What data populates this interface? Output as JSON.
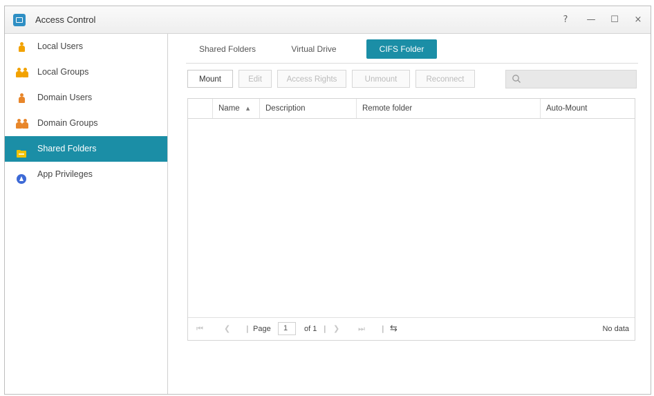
{
  "window": {
    "title": "Access Control",
    "controls": {
      "help": "?",
      "minimize": "—",
      "maximize": "☐",
      "close": "×"
    }
  },
  "sidebar": {
    "items": [
      {
        "label": "Local Users",
        "icon": "user-icon",
        "active": false
      },
      {
        "label": "Local Groups",
        "icon": "group-icon",
        "active": false
      },
      {
        "label": "Domain Users",
        "icon": "user-icon",
        "active": false
      },
      {
        "label": "Domain Groups",
        "icon": "group-icon",
        "active": false
      },
      {
        "label": "Shared Folders",
        "icon": "folder-icon",
        "active": true
      },
      {
        "label": "App Privileges",
        "icon": "app-icon",
        "active": false
      }
    ]
  },
  "tabs": [
    {
      "label": "Shared Folders",
      "active": false
    },
    {
      "label": "Virtual Drive",
      "active": false
    },
    {
      "label": "CIFS Folder",
      "active": true
    }
  ],
  "toolbar": {
    "buttons": [
      {
        "label": "Mount",
        "enabled": true
      },
      {
        "label": "Edit",
        "enabled": false
      },
      {
        "label": "Access Rights",
        "enabled": false
      },
      {
        "label": "Unmount",
        "enabled": false
      },
      {
        "label": "Reconnect",
        "enabled": false
      }
    ],
    "search": {
      "placeholder": "",
      "value": ""
    }
  },
  "grid": {
    "columns": [
      "Name",
      "Description",
      "Remote folder",
      "Auto-Mount"
    ],
    "sort_indicator": "▲",
    "rows": []
  },
  "pager": {
    "page_label": "Page",
    "page_value": "1",
    "of_label": "of 1",
    "status": "No data"
  },
  "colors": {
    "accent": "#1b8ea6",
    "user_icon": "#f2a200",
    "group_icon": "#e8862a",
    "folder_icon": "#f2c200",
    "app_icon": "#3d6ad6"
  }
}
